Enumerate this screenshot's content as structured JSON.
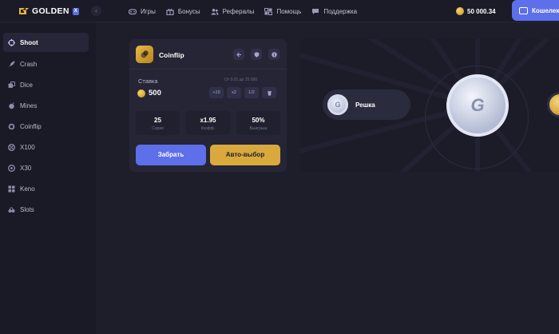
{
  "brand": {
    "name": "GOLDEN",
    "badge": "X"
  },
  "nav": [
    {
      "label": "Игры",
      "icon": "gamepad-icon"
    },
    {
      "label": "Бонусы",
      "icon": "gift-icon"
    },
    {
      "label": "Рефералы",
      "icon": "users-icon"
    },
    {
      "label": "Помощь",
      "icon": "help-icon"
    },
    {
      "label": "Поддержка",
      "icon": "chat-icon"
    }
  ],
  "balance": "50 000.34",
  "wallet_label": "Кошелек",
  "sidebar": [
    {
      "label": "Shoot",
      "icon": "crosshair-icon",
      "active": true
    },
    {
      "label": "Crash",
      "icon": "rocket-icon"
    },
    {
      "label": "Dice",
      "icon": "dice-icon"
    },
    {
      "label": "Mines",
      "icon": "mine-icon"
    },
    {
      "label": "Coinflip",
      "icon": "coin-icon"
    },
    {
      "label": "X100",
      "icon": "wheel-icon"
    },
    {
      "label": "X30",
      "icon": "wheel-icon"
    },
    {
      "label": "Keno",
      "icon": "grid-icon"
    },
    {
      "label": "Slots",
      "icon": "slots-icon"
    }
  ],
  "game": {
    "title": "Coinflip",
    "bet_label": "Ставка",
    "bet_value": "500",
    "range_text": "От 0.01 до 25 000",
    "quick": [
      "+10",
      "x2",
      "1/2"
    ],
    "stats": [
      {
        "value": "25",
        "label": "Серия"
      },
      {
        "value": "x1.95",
        "label": "Коэфф."
      },
      {
        "value": "50%",
        "label": "Выигрыш"
      }
    ],
    "primary_label": "Забрать",
    "secondary_label": "Авто-выбор"
  },
  "arena": {
    "side_label": "Решка",
    "coin_mark": "G"
  },
  "colors": {
    "accent": "#5d6fe9",
    "gold": "#d9a93e",
    "background": "#1e1e2b"
  }
}
